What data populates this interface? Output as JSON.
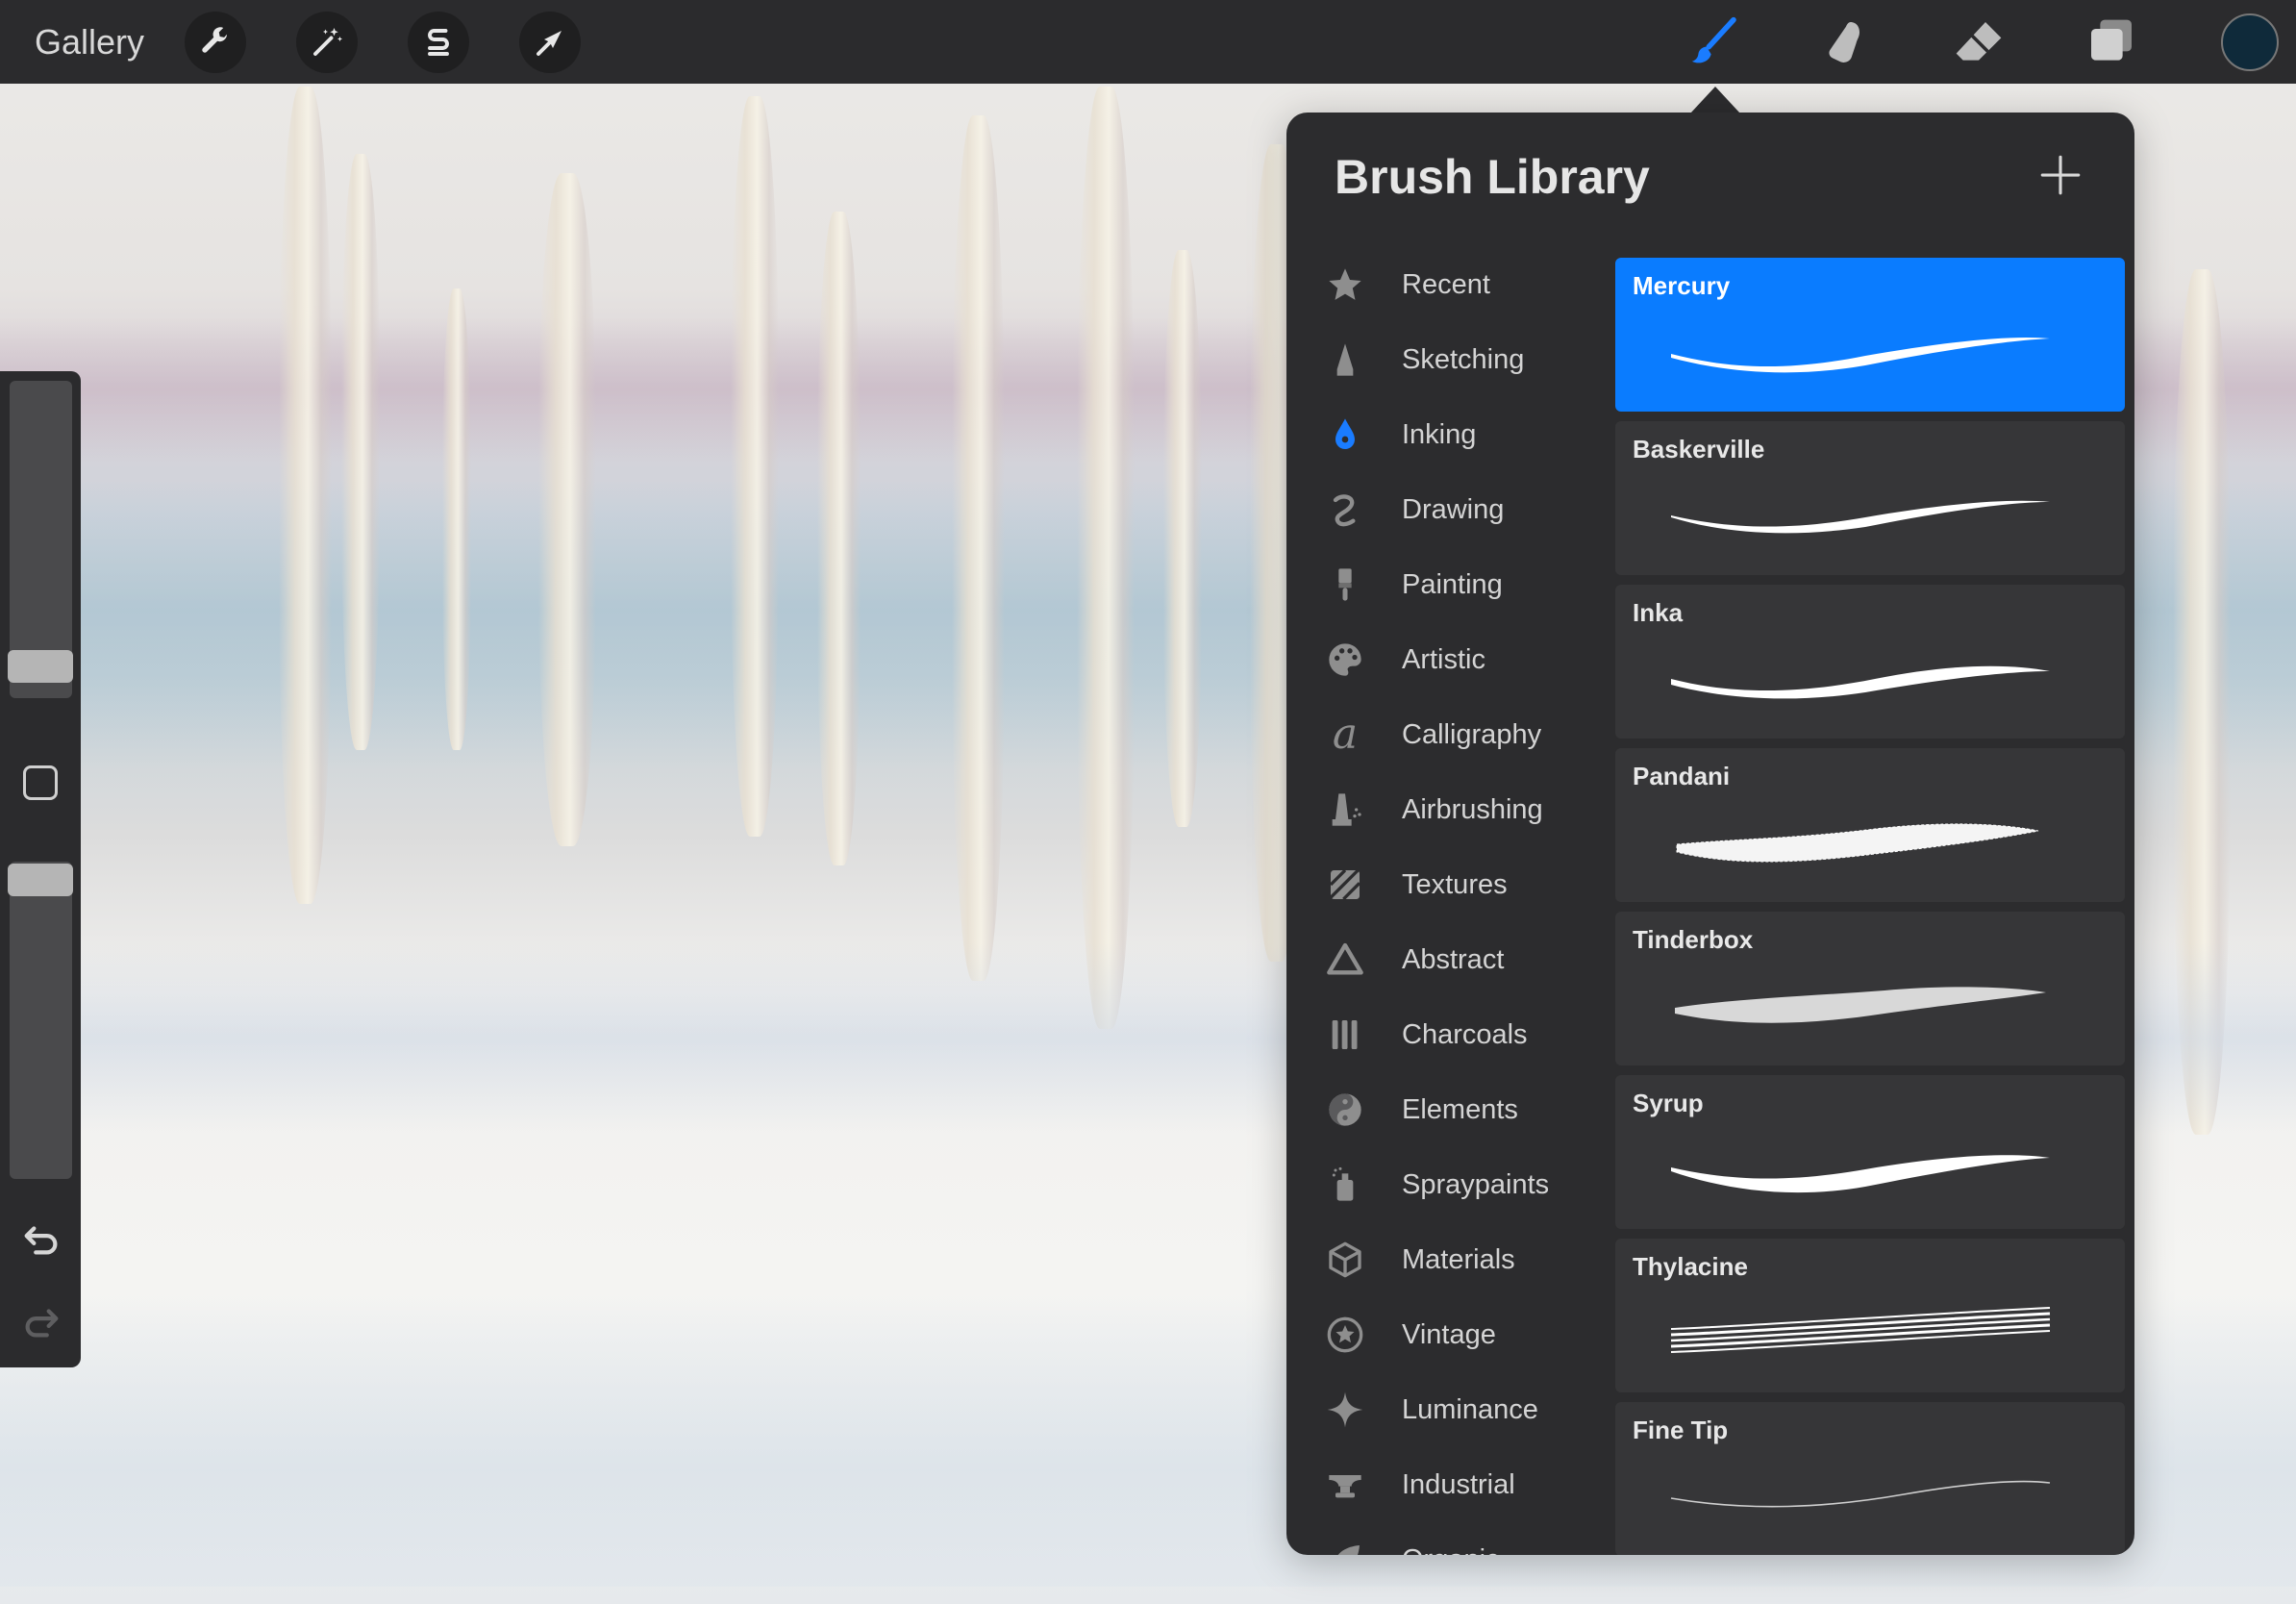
{
  "topbar": {
    "gallery_label": "Gallery",
    "left_tools": [
      {
        "name": "actions",
        "icon": "wrench-icon"
      },
      {
        "name": "adjustments",
        "icon": "magic-wand-icon"
      },
      {
        "name": "selection",
        "icon": "selection-s-icon"
      },
      {
        "name": "transform",
        "icon": "arrow-cursor-icon"
      }
    ],
    "right_tools": [
      {
        "name": "brush",
        "icon": "brush-icon",
        "active": true
      },
      {
        "name": "smudge",
        "icon": "smudge-finger-icon"
      },
      {
        "name": "eraser",
        "icon": "eraser-icon"
      },
      {
        "name": "layers",
        "icon": "layers-icon"
      }
    ],
    "active_color": "#0f2a3a",
    "accent_color": "#1a7cff"
  },
  "sidebar": {
    "brush_size_fraction": 0.15,
    "brush_opacity_fraction": 0.95,
    "undo_icon": "undo-icon",
    "redo_icon": "redo-icon"
  },
  "brush_library": {
    "title": "Brush Library",
    "categories": [
      {
        "label": "Recent",
        "icon": "star-icon"
      },
      {
        "label": "Sketching",
        "icon": "pencil-tip-icon"
      },
      {
        "label": "Inking",
        "icon": "ink-drop-icon",
        "selected": true
      },
      {
        "label": "Drawing",
        "icon": "squiggle-icon"
      },
      {
        "label": "Painting",
        "icon": "paintbrush-icon"
      },
      {
        "label": "Artistic",
        "icon": "palette-icon"
      },
      {
        "label": "Calligraphy",
        "icon": "calligraphy-a-icon"
      },
      {
        "label": "Airbrushing",
        "icon": "airbrush-icon"
      },
      {
        "label": "Textures",
        "icon": "hatch-texture-icon"
      },
      {
        "label": "Abstract",
        "icon": "triangle-icon"
      },
      {
        "label": "Charcoals",
        "icon": "charcoal-sticks-icon"
      },
      {
        "label": "Elements",
        "icon": "yin-yang-icon"
      },
      {
        "label": "Spraypaints",
        "icon": "spray-can-icon"
      },
      {
        "label": "Materials",
        "icon": "cube-icon"
      },
      {
        "label": "Vintage",
        "icon": "star-badge-icon"
      },
      {
        "label": "Luminance",
        "icon": "sparkle-icon"
      },
      {
        "label": "Industrial",
        "icon": "anvil-icon"
      },
      {
        "label": "Organic",
        "icon": "leaf-icon"
      }
    ],
    "brushes": [
      {
        "name": "Mercury",
        "selected": true
      },
      {
        "name": "Baskerville"
      },
      {
        "name": "Inka"
      },
      {
        "name": "Pandani"
      },
      {
        "name": "Tinderbox"
      },
      {
        "name": "Syrup"
      },
      {
        "name": "Thylacine"
      },
      {
        "name": "Fine Tip"
      }
    ]
  }
}
